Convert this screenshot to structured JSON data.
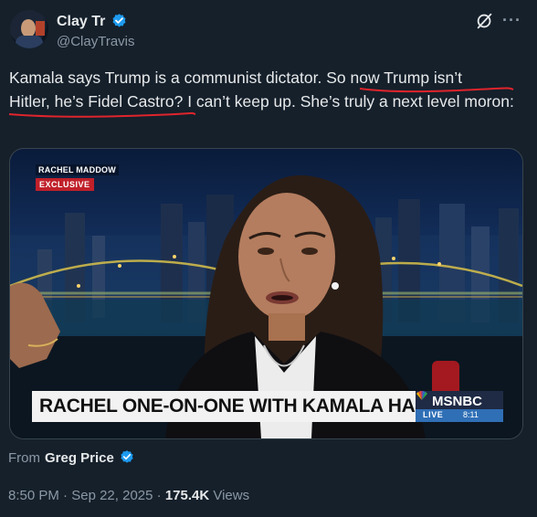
{
  "author": {
    "display_name": "Clay Tr",
    "handle": "@ClayTravis",
    "verified": true
  },
  "header_icons": [
    "grok-icon",
    "more-icon"
  ],
  "more_label": "···",
  "tweet": {
    "text_part1": "Kamala says Trump is a communist dictator. ",
    "text_underlined_1": "So now Trump isn’t",
    "text_line_break": " ",
    "text_underlined_2": "Hitler, he’s Fidel Castro",
    "text_part2": "? I can’t keep up. She’s truly a next level moron:"
  },
  "media": {
    "logo_text": "RACHEL MADDOW",
    "badge_text": "EXCLUSIVE",
    "chyron_text": "RACHEL ONE-ON-ONE WITH KAMALA HARRIS",
    "network": "MSNBC",
    "live_label": "LIVE",
    "live_time": "8:11"
  },
  "source": {
    "from_label": "From",
    "from_name": "Greg Price",
    "verified": true
  },
  "meta": {
    "time": "8:50 PM",
    "sep1": " · ",
    "date": "Sep 22, 2025",
    "sep2": " · ",
    "views_count": "175.4K",
    "views_label": " Views"
  },
  "colors": {
    "background": "#15202b",
    "verified_blue": "#1d9bf0",
    "secondary_text": "#8b98a5",
    "underline_red": "#e0242c"
  }
}
